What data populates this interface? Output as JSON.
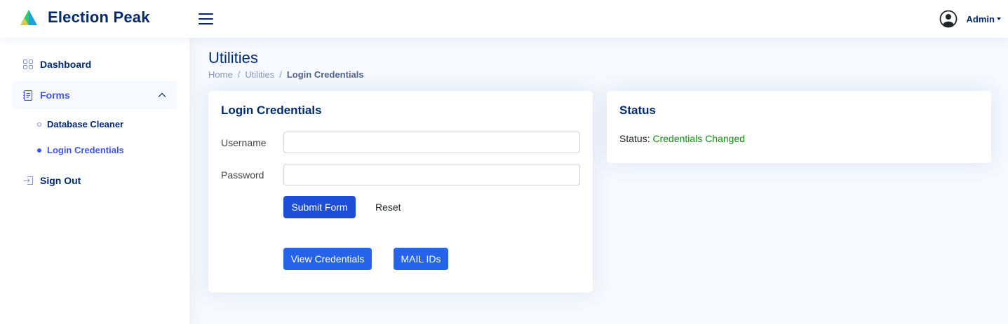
{
  "header": {
    "app_name": "Election Peak",
    "profile_name": "Admin"
  },
  "sidebar": {
    "items": [
      {
        "label": "Dashboard",
        "icon": "grid-icon"
      },
      {
        "label": "Forms",
        "icon": "journal-text-icon"
      },
      {
        "label": "Sign Out",
        "icon": "box-arrow-in-right-icon"
      }
    ],
    "sub_items": [
      {
        "label": "Database Cleaner"
      },
      {
        "label": "Login Credentials"
      }
    ]
  },
  "page": {
    "title": "Utilities",
    "breadcrumb": [
      "Home",
      "Utilities",
      "Login Credentials"
    ],
    "breadcrumb_sep": "/"
  },
  "login_card": {
    "title": "Login Credentials",
    "username_label": "Username",
    "username_value": "",
    "password_label": "Password",
    "password_value": "",
    "submit_label": "Submit Form",
    "reset_label": "Reset",
    "view_label": "View Credentials",
    "mail_label": "MAIL IDs"
  },
  "status_card": {
    "title": "Status",
    "status_prefix": "Status:",
    "status_value": "Credentials Changed"
  },
  "colors": {
    "brand": "#012970",
    "accent": "#4154f1",
    "button_primary": "#1d4ed8",
    "success": "#138a13"
  }
}
